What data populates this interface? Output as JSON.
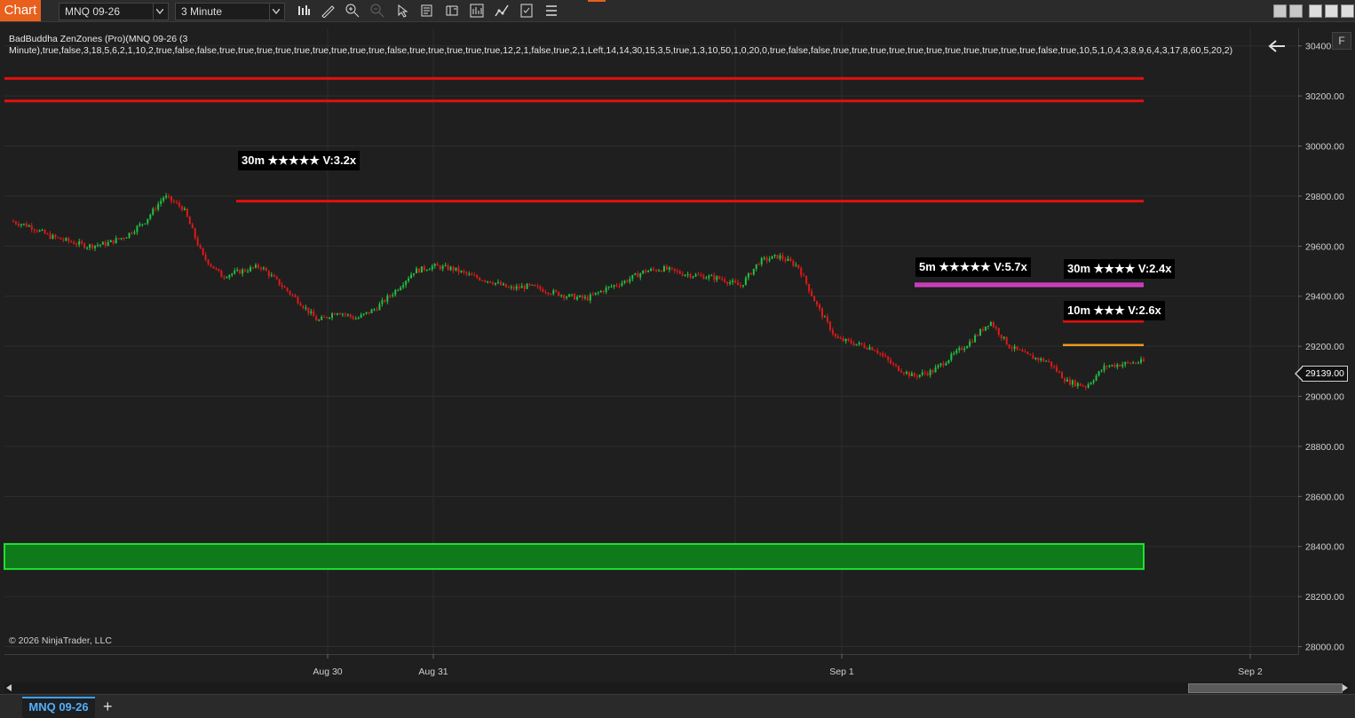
{
  "toolbar": {
    "chart_label": "Chart",
    "instrument": "MNQ 09-26",
    "interval": "3 Minute",
    "icons": [
      "bar-type-icon",
      "draw-tool-icon",
      "zoom-in-icon",
      "zoom-out-icon",
      "pointer-icon",
      "data-box-icon",
      "templates-icon",
      "indicators-icon",
      "strategies-icon",
      "properties-icon",
      "more-icon"
    ]
  },
  "indicator": {
    "line1": "BadBuddha ZenZones (Pro)(MNQ 09-26 (3",
    "line2": "Minute),true,false,3,18,5,6,2,1,10,2,true,false,false,true,true,true,true,true,true,true,true,true,false,true,true,true,true,true,12,2,1,false,true,2,1,Left,14,14,30,15,3,5,true,1,3,10,50,1,0,20,0,true,false,false,true,true,true,true,true,true,true,true,true,true,true,false,true,10,5,1,0,4,3,8,9,6,4,3,17,8,60,5,20,2)"
  },
  "f_button": "F",
  "copyright": "© 2026 NinjaTrader, LLC",
  "y_axis": [
    "30400.00",
    "30200.00",
    "30000.00",
    "29800.00",
    "29600.00",
    "29400.00",
    "29200.00",
    "29000.00",
    "28800.00",
    "28600.00",
    "28400.00",
    "28200.00",
    "28000.00"
  ],
  "x_axis": [
    "Aug 30",
    "Aug 31",
    "Sep 1",
    "Sep 2"
  ],
  "current_price": "29139.00",
  "zone_labels": {
    "z1": "30m ★★★★★ V:3.2x",
    "z2": "5m ★★★★★ V:5.7x",
    "z3": "30m ★★★★ V:2.4x",
    "z4": "10m ★★★ V:2.6x"
  },
  "colors": {
    "resistance": "#e01010",
    "support_fill": "#0e7a1a",
    "support_border": "#22e032",
    "magenta_zone": "#d040c0",
    "orange_line": "#e89a20",
    "up_candle": "#22c040",
    "down_candle": "#e01818"
  },
  "bottom_tab": "MNQ 09-26",
  "add_tab": "+",
  "chart_data": {
    "type": "candlestick",
    "x": [
      "Aug 30",
      "Aug 31",
      "Sep 1",
      "Sep 2"
    ],
    "ylim": [
      27970,
      30470
    ],
    "y_ticks": [
      30400,
      30200,
      30000,
      29800,
      29600,
      29400,
      29200,
      29000,
      28800,
      28600,
      28400,
      28200,
      28000
    ],
    "price_path": [
      29700,
      29680,
      29640,
      29620,
      29600,
      29610,
      29640,
      29700,
      29800,
      29750,
      29560,
      29480,
      29500,
      29520,
      29450,
      29380,
      29300,
      29340,
      29310,
      29350,
      29420,
      29500,
      29520,
      29510,
      29480,
      29460,
      29430,
      29440,
      29420,
      29400,
      29390,
      29430,
      29460,
      29500,
      29510,
      29490,
      29480,
      29470,
      29440,
      29540,
      29560,
      29520,
      29360,
      29230,
      29210,
      29190,
      29120,
      29080,
      29100,
      29160,
      29220,
      29300,
      29200,
      29160,
      29140,
      29060,
      29040,
      29120,
      29130,
      29139
    ],
    "zones": [
      {
        "kind": "resistance",
        "price": 30270
      },
      {
        "kind": "resistance",
        "price": 30180
      },
      {
        "kind": "resistance",
        "price": 29780
      },
      {
        "kind": "magenta",
        "price_top": 29450,
        "price_bottom": 29430
      },
      {
        "kind": "resistance",
        "price": 29300
      },
      {
        "kind": "orange",
        "price": 29205
      },
      {
        "kind": "support",
        "price_top": 28410,
        "price_bottom": 28310
      }
    ],
    "last_price": 29139
  }
}
